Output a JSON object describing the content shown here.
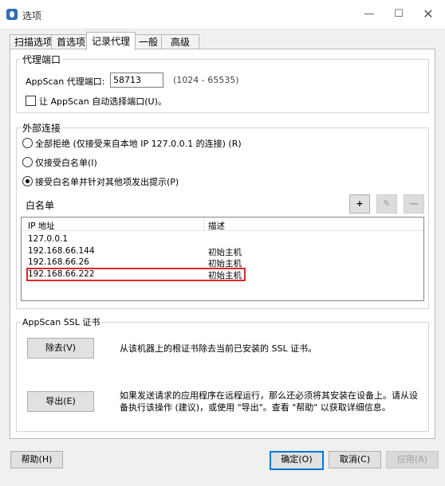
{
  "window": {
    "title": "选项",
    "minimize": "—",
    "maximize": "☐",
    "close": "✕",
    "icon": "appscan-app-icon"
  },
  "tabs": [
    {
      "label": "扫描选项",
      "active": false
    },
    {
      "label": "首选项",
      "active": false
    },
    {
      "label": "记录代理",
      "active": true
    },
    {
      "label": "一般",
      "active": false
    },
    {
      "label": "高级",
      "active": false
    }
  ],
  "proxy_port": {
    "group_label": "代理端口",
    "port_label": "AppScan 代理端口:",
    "port_value": "58713",
    "port_range": "(1024 - 65535)",
    "auto_select_label": "让 AppScan 自动选择端口(U)。",
    "auto_select_checked": false
  },
  "external": {
    "group_label": "外部连接",
    "options": [
      {
        "label": "全部拒绝 (仅接受来自本地 IP 127.0.0.1 的连接) (R)",
        "selected": false
      },
      {
        "label": "仅接受白名单(I)",
        "selected": false
      },
      {
        "label": "接受白名单并针对其他项发出提示(P)",
        "selected": true
      }
    ],
    "whitelist_label": "白名单",
    "add_icon": "+",
    "edit_icon": "✎",
    "remove_icon": "—",
    "columns": [
      "IP 地址",
      "描述"
    ],
    "rows": [
      {
        "ip": "127.0.0.1",
        "desc": ""
      },
      {
        "ip": "192.168.66.144",
        "desc": "初始主机"
      },
      {
        "ip": "192.168.66.26",
        "desc": "初始主机"
      },
      {
        "ip": "192.168.66.222",
        "desc": "初始主机"
      }
    ]
  },
  "ssl": {
    "group_label": "AppScan SSL 证书",
    "remove_button": "除去(V)",
    "remove_desc": "从该机器上的根证书除去当前已安装的 SSL 证书。",
    "export_button": "导出(E)",
    "export_desc_1": "如果发送请求的应用程序在远程运行，那么还必须将其安装在设备上。请从设",
    "export_desc_2": "备执行该操作 (建议)，或使用 \"导出\"。查看 \"帮助\" 以获取详细信息。"
  },
  "footer": {
    "help": "帮助(H)",
    "ok": "确定(O)",
    "cancel": "取消(C)",
    "apply": "应用(A)"
  },
  "colors": {
    "highlight": "#e0262b",
    "accent": "#0078d7"
  }
}
